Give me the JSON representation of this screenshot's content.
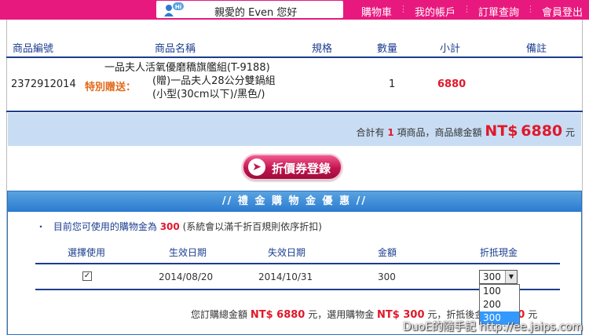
{
  "topbar": {
    "greeting": "親愛的 Even 您好",
    "hi": "Hi",
    "nav": [
      "購物車",
      "我的帳戶",
      "訂單查詢",
      "會員登出"
    ],
    "sep": "⋮"
  },
  "order": {
    "headers": {
      "sku": "商品編號",
      "name": "商品名稱",
      "spec": "規格",
      "qty": "數量",
      "subtotal": "小計",
      "note": "備註"
    },
    "item": {
      "sku": "2372912014",
      "gift_label": "特別贈送：",
      "name_line1": "一品夫人活氧優磨穚旗艦組(T-9188)",
      "name_line2": "(贈)一品夫人28公分雙鍋組",
      "name_line3": "(小型(30cm以下)/黑色/)",
      "qty": "1",
      "subtotal": "6880"
    },
    "summary": {
      "prefix": "合計有",
      "count": "1",
      "middle": "項商品，商品總金額",
      "currency": "NT$",
      "total": "6880",
      "suffix": "元"
    }
  },
  "coupon_button": {
    "label": "折價券登錄",
    "icon": "➤"
  },
  "gift_panel": {
    "title": "// 禮 金 購 物 金 優 惠 //",
    "available_prefix": "目前您可使用的購物金為",
    "available_amount": "300",
    "available_note": "(系統會以滿千折百規則依序折扣)",
    "bullet": "・",
    "headers": {
      "select": "選擇使用",
      "start": "生效日期",
      "end": "失效日期",
      "amount": "金額",
      "discount": "折抵現金"
    },
    "row": {
      "checked": "✓",
      "start": "2014/08/20",
      "end": "2014/10/31",
      "amount": "300",
      "discount_selected": "300"
    },
    "dropdown_options": [
      "100",
      "200",
      "300"
    ],
    "dropdown_arrow": "▼"
  },
  "bottom": {
    "t1": "您訂購總金額",
    "total": "NT$ 6880",
    "t2": "元，選用購物金",
    "used": "NT$ 300",
    "t3": "元，折抵後金額",
    "final": "6580",
    "t4": "元"
  },
  "watermark": "DuoE的隨手記 http://ee.jaips.com",
  "colors": {
    "brand_pink": "#e8197e",
    "navy": "#1b3d8a",
    "summary_bg": "#c8ddf3",
    "price_red": "#e1182a",
    "gift_orange": "#e26a1a"
  }
}
